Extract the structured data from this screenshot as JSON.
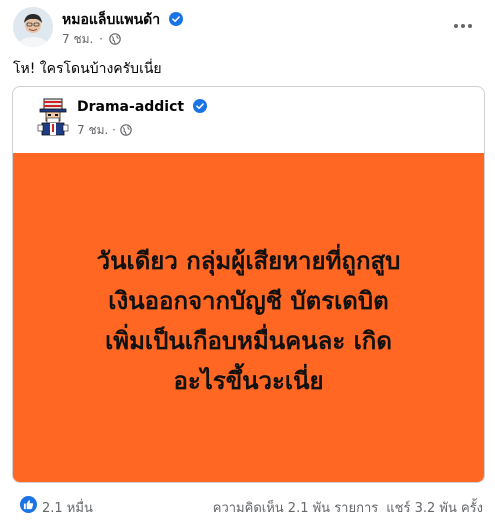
{
  "post": {
    "author": "หมอแล็บแพนด้า",
    "time": "7 ชม.",
    "separator": "·",
    "caption": "โห! ใครโดนบ้างครับเนี่ย",
    "more_icon": "more-horizontal-icon",
    "audience_icon": "globe-icon",
    "verified_icon": "verified-badge-icon"
  },
  "shared_post": {
    "author": "Drama-addict",
    "time": "7 ชม.",
    "separator": "·",
    "headline_lines": [
      "วันเดียว กลุ่มผู้เสียหายที่ถูกสูบ",
      "เงินออกจากบัญชี บัตรเดบิต",
      "เพิ่มเป็นเกือบหมื่นคนละ เกิด",
      "อะไรขึ้นวะเนี่ย"
    ],
    "background_color": "#ff6722"
  },
  "footer": {
    "reaction_icon": "like-icon",
    "reactions": "2.1 หมื่น",
    "comments": "ความคิดเห็น 2.1 พัน รายการ",
    "shares": "แชร์ 3.2 พัน ครั้ง"
  },
  "colors": {
    "brand_blue": "#1b74e4",
    "secondary_text": "#65676b",
    "border": "#ced0d4"
  }
}
